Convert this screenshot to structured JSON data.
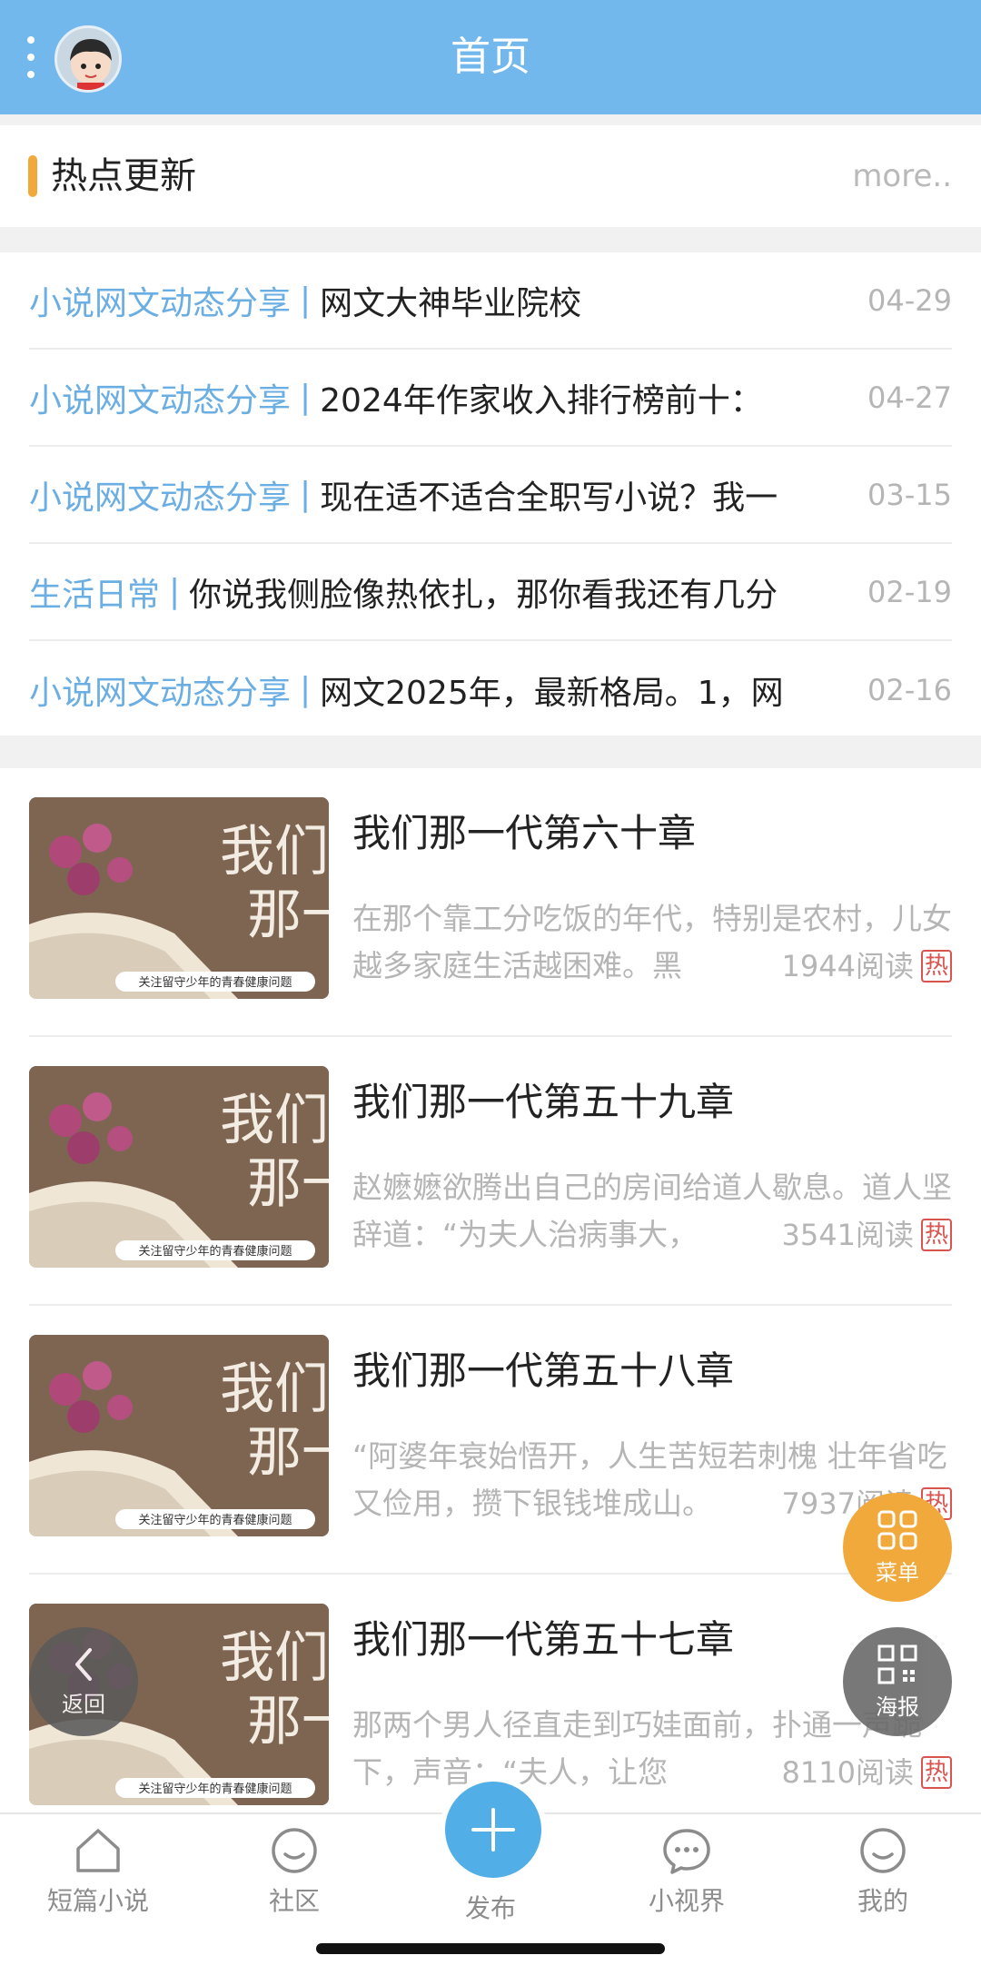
{
  "header": {
    "title": "首页"
  },
  "hot": {
    "heading": "热点更新",
    "more": "more..",
    "items": [
      {
        "category": "小说网文动态分享",
        "title": "网文大神毕业院校",
        "date": "04-29"
      },
      {
        "category": "小说网文动态分享",
        "title": "2024年作家收入排行榜前十：",
        "date": "04-27"
      },
      {
        "category": "小说网文动态分享",
        "title": "现在适不适合全职写小说？我一",
        "date": "03-15"
      },
      {
        "category": "生活日常",
        "title": "你说我侧脸像热依扎，那你看我还有几分",
        "date": "02-19"
      },
      {
        "category": "小说网文动态分享",
        "title": "网文2025年，最新格局。1，网",
        "date": "02-16"
      }
    ]
  },
  "articles": [
    {
      "title": "我们那一代第六十章",
      "summary": "在那个靠工分吃饭的年代，特别是农村，儿女越多家庭生活越困难。黑",
      "reads": "1944阅读",
      "tag": "热",
      "thumb_text": "我们那一",
      "thumb_caption": "关注留守少年的青春健康问题"
    },
    {
      "title": "我们那一代第五十九章",
      "summary": "赵嬷嬷欲腾出自己的房间给道人歇息。道人坚辞道：“为夫人治病事大，",
      "reads": "3541阅读",
      "tag": "热",
      "thumb_text": "我们那一",
      "thumb_caption": "关注留守少年的青春健康问题"
    },
    {
      "title": "我们那一代第五十八章",
      "summary": "“阿婆年衰始悟开，人生苦短若刺槐 壮年省吃又俭用，攒下银钱堆成山。",
      "reads": "7937阅读",
      "tag": "热",
      "thumb_text": "我们那一",
      "thumb_caption": "关注留守少年的青春健康问题"
    },
    {
      "title": "我们那一代第五十七章",
      "summary": "那两个男人径直走到巧娃面前，扑通一声跪下，声音：“夫人，让您",
      "reads": "8110阅读",
      "tag": "热",
      "thumb_text": "我们那一",
      "thumb_caption": "关注留守少年的青春健康问题"
    }
  ],
  "fabs": {
    "menu": "菜单",
    "poster": "海报",
    "back": "返回"
  },
  "nav": {
    "items": [
      "短篇小说",
      "社区",
      "发布",
      "小视界",
      "我的"
    ]
  },
  "colors": {
    "header": "#73b8ec",
    "accent": "#f2a93b",
    "category": "#6aaee3",
    "publish": "#52aee7",
    "hot_tag": "#d9534f"
  }
}
